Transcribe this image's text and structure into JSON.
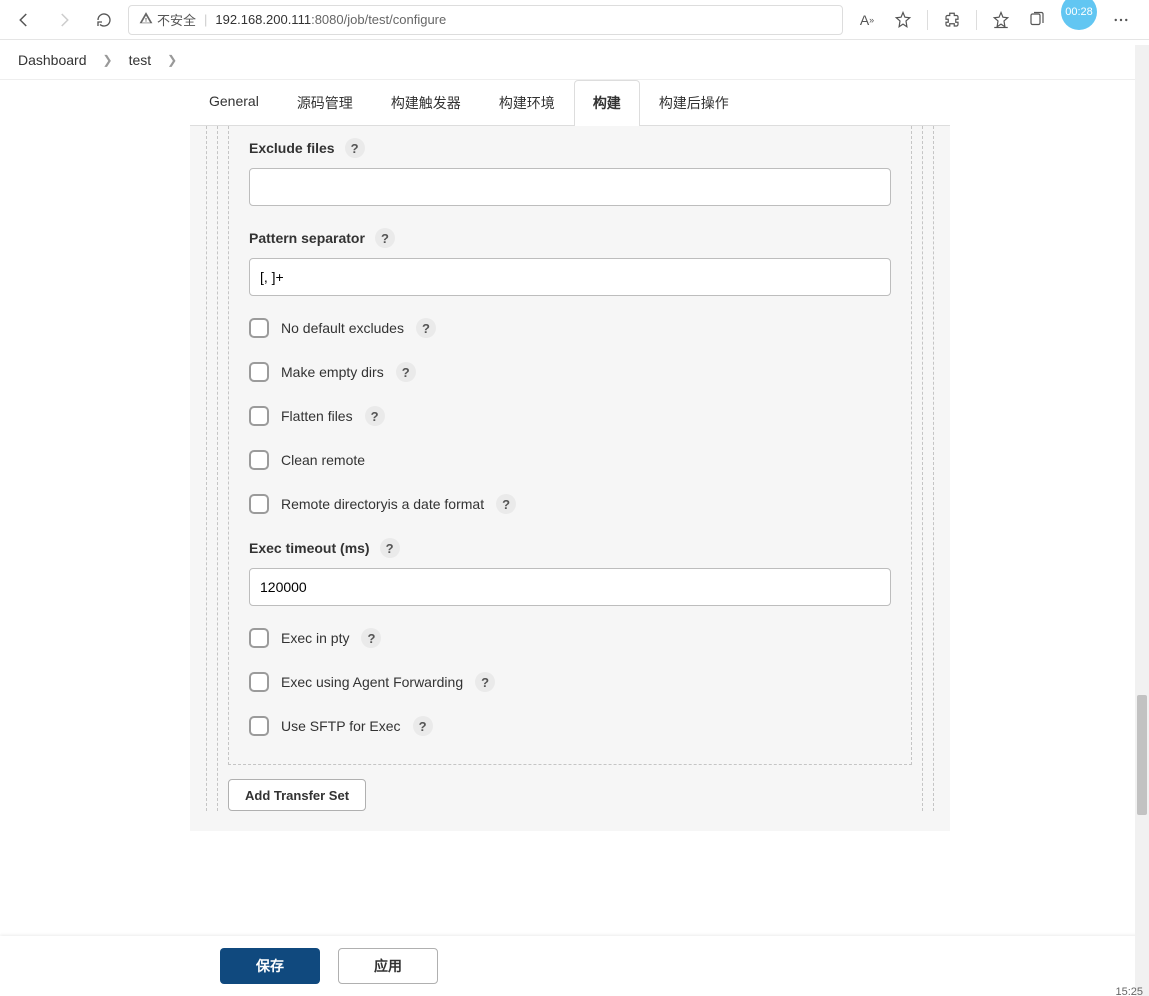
{
  "browser": {
    "insecure_label": "不安全",
    "url_host": "192.168.200.111",
    "url_port": ":8080",
    "url_path": "/job/test/configure",
    "timer_badge": "00:28"
  },
  "breadcrumb": {
    "item0": "Dashboard",
    "item1": "test"
  },
  "tabs": {
    "t0": "General",
    "t1": "源码管理",
    "t2": "构建触发器",
    "t3": "构建环境",
    "t4": "构建",
    "t5": "构建后操作"
  },
  "form": {
    "exclude_files_label": "Exclude files",
    "exclude_files_value": "",
    "pattern_sep_label": "Pattern separator",
    "pattern_sep_value": "[, ]+",
    "no_default_excludes": "No default excludes",
    "make_empty_dirs": "Make empty dirs",
    "flatten_files": "Flatten files",
    "clean_remote": "Clean remote",
    "remote_dir_date": "Remote directoryis a date format",
    "exec_timeout_label": "Exec timeout (ms)",
    "exec_timeout_value": "120000",
    "exec_in_pty": "Exec in pty",
    "exec_agent_fwd": "Exec using Agent Forwarding",
    "use_sftp": "Use SFTP for Exec",
    "add_transfer_set": "Add Transfer Set",
    "help": "?"
  },
  "footer": {
    "save": "保存",
    "apply": "应用"
  },
  "system": {
    "clock": "15:25"
  }
}
